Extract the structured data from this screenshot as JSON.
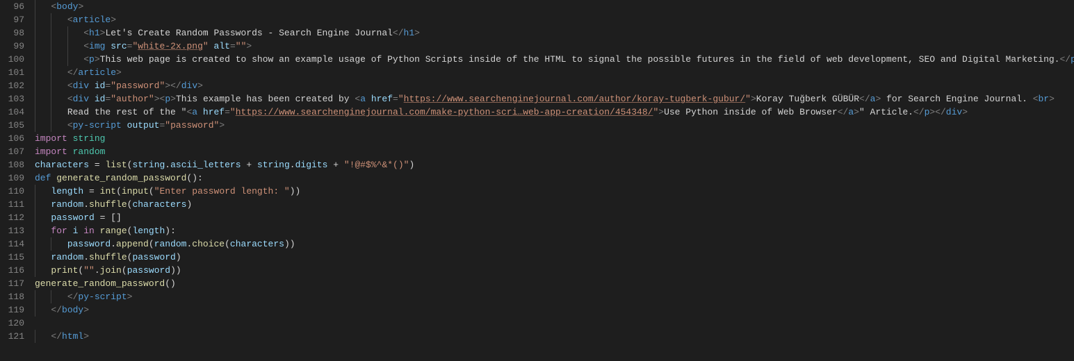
{
  "lines": {
    "start": 96,
    "end": 121,
    "numbers": [
      "96",
      "97",
      "98",
      "99",
      "100",
      "101",
      "102",
      "103",
      "104",
      "105",
      "106",
      "107",
      "108",
      "109",
      "110",
      "111",
      "112",
      "113",
      "114",
      "115",
      "116",
      "117",
      "118",
      "119",
      "120",
      "121"
    ]
  },
  "code": {
    "l96_tag": "body",
    "l97_tag": "article",
    "l98_tag": "h1",
    "l98_text": "Let's Create Random Passwords - Search Engine Journal",
    "l99_tag": "img",
    "l99_attr1": "src",
    "l99_val1": "white-2x.png",
    "l99_attr2": "alt",
    "l99_val2": "",
    "l100_tag": "p",
    "l100_text": "This web page is created to show an example usage of Python Scripts inside of the HTML to signal the possible futures in the field of web development, SEO and Digital Marketing.",
    "l101_tag": "article",
    "l102_tag": "div",
    "l102_attr": "id",
    "l102_val": "password",
    "l103_tag_div": "div",
    "l103_attr_id": "id",
    "l103_val_id": "author",
    "l103_tag_p": "p",
    "l103_text1": "This example has been created by ",
    "l103_tag_a": "a",
    "l103_attr_href": "href",
    "l103_href1": "https://www.searchenginejournal.com/author/koray-tugberk-gubur/",
    "l103_linktext1": "Koray Tuğberk GÜBÜR",
    "l103_text2": " for Search Engine Journal. ",
    "l103_tag_br": "br",
    "l104_text1": "Read the rest of the \"",
    "l104_href": "https://www.searchenginejournal.com/make-python-scri…web-app-creation/454348/",
    "l104_linktext": "Use Python inside of Web Browser",
    "l104_text2": "\" Article.",
    "l105_tag": "py-script",
    "l105_attr": "output",
    "l105_val": "password",
    "l106": "import string",
    "l107": "import random",
    "l108_a": "characters = ",
    "l108_b": "list",
    "l108_c": "(string.ascii_letters + string.digits + ",
    "l108_d": "\"!@#$%^&*()\"",
    "l108_e": ")",
    "l109_a": "def ",
    "l109_b": "generate_random_password",
    "l109_c": "():",
    "l110_a": "length = ",
    "l110_b": "int",
    "l110_c": "(",
    "l110_d": "input",
    "l110_e": "(",
    "l110_f": "\"Enter password length: \"",
    "l110_g": "))",
    "l111": "random.shuffle(characters)",
    "l112": "password = []",
    "l113_a": "for",
    "l113_b": " i ",
    "l113_c": "in",
    "l113_d": " ",
    "l113_e": "range",
    "l113_f": "(length):",
    "l114_a": "password.append(random.choice(characters))",
    "l115": "random.shuffle(password)",
    "l116_a": "print",
    "l116_b": "(",
    "l116_c": "\"\"",
    "l116_d": ".join(password))",
    "l117": "generate_random_password()",
    "l118_tag": "py-script",
    "l119_tag": "body",
    "l121_tag": "html"
  }
}
